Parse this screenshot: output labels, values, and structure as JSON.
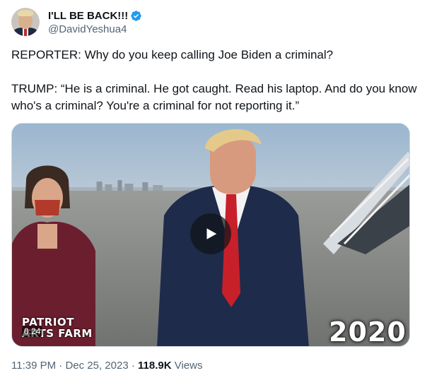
{
  "author": {
    "display_name": "I'LL BE BACK!!!",
    "handle": "@DavidYeshua4",
    "verified": true
  },
  "tweet": {
    "paragraphs": [
      "REPORTER: Why do you keep calling Joe Biden a criminal?",
      "TRUMP: “He is a criminal. He got caught. Read his laptop. And do you know who's a criminal? You're a criminal for not reporting it.”"
    ]
  },
  "media": {
    "type": "video",
    "duration": "0:24",
    "watermark_line1": "PATRIOT",
    "watermark_line2": "ARTS FARM",
    "year_overlay": "2020",
    "play_icon": "play-icon"
  },
  "meta": {
    "time": "11:39 PM",
    "separator": "·",
    "date": "Dec 25, 2023",
    "views_count": "118.9K",
    "views_label": "Views"
  },
  "colors": {
    "verified_blue": "#1d9bf0",
    "secondary_text": "#536471",
    "primary_text": "#0f1419"
  }
}
